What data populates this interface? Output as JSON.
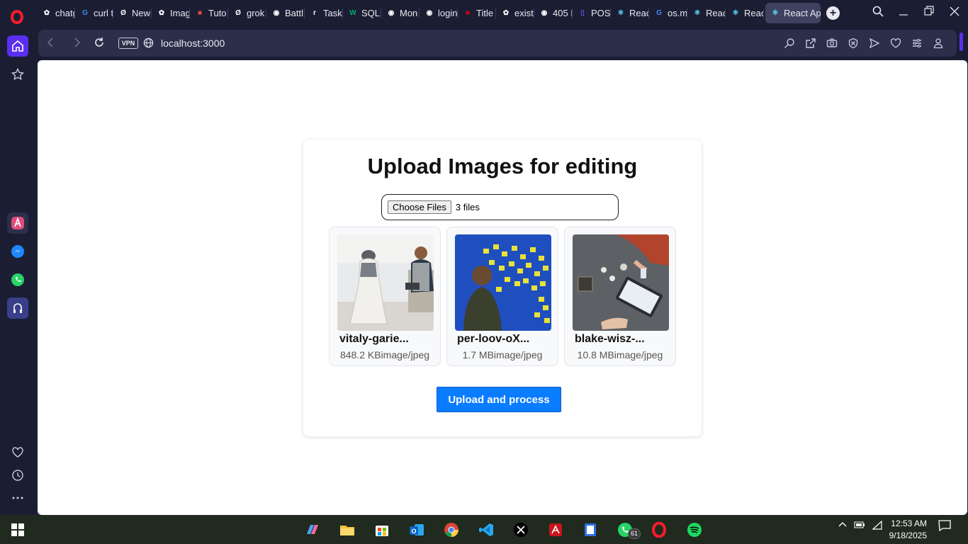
{
  "browser": {
    "tabs": [
      {
        "label": "chatgpt",
        "favicon": "openai-icon",
        "color": "#ffffff"
      },
      {
        "label": "curl t",
        "favicon": "google-icon",
        "color": "#4285f4"
      },
      {
        "label": "New",
        "favicon": "perplexity-icon",
        "color": "#ffffff"
      },
      {
        "label": "Imag",
        "favicon": "openai-icon",
        "color": "#ffffff"
      },
      {
        "label": "Tuto",
        "favicon": "site-icon",
        "color": "#e24a3b"
      },
      {
        "label": "grok",
        "favicon": "grok-icon",
        "color": "#ffffff"
      },
      {
        "label": "Battl",
        "favicon": "globe-icon",
        "color": "#ffffff"
      },
      {
        "label": "Task",
        "favicon": "r-icon",
        "color": "#ffffff"
      },
      {
        "label": "SQL",
        "favicon": "w3-icon",
        "color": "#04aa6d"
      },
      {
        "label": "Mon",
        "favicon": "globe-icon",
        "color": "#ffffff"
      },
      {
        "label": "login",
        "favicon": "globe-icon",
        "color": "#ffffff"
      },
      {
        "label": "Title",
        "favicon": "site-icon",
        "color": "#d0021b"
      },
      {
        "label": "exist",
        "favicon": "openai-icon",
        "color": "#ffffff"
      },
      {
        "label": "405 I",
        "favicon": "globe-icon",
        "color": "#ffffff"
      },
      {
        "label": "POST",
        "favicon": "doc-icon",
        "color": "#6b4cf6"
      },
      {
        "label": "Reac",
        "favicon": "react-icon",
        "color": "#61dafb"
      },
      {
        "label": "os.m",
        "favicon": "google-icon",
        "color": "#4285f4"
      },
      {
        "label": "Reac",
        "favicon": "react-icon",
        "color": "#61dafb"
      },
      {
        "label": "Reac",
        "favicon": "react-icon",
        "color": "#61dafb"
      }
    ],
    "active_tab": {
      "label": "React App",
      "favicon": "react-icon"
    },
    "url": "localhost:3000",
    "vpn_label": "VPN"
  },
  "page": {
    "title": "Upload Images for editing",
    "file_input": {
      "button_label": "Choose Files",
      "status": "3 files"
    },
    "files": [
      {
        "name": "vitaly-garie...",
        "meta": "848.2 KBimage/jpeg",
        "thumb": "dress-form-photo"
      },
      {
        "name": "per-loov-oX...",
        "meta": "1.7 MBimage/jpeg",
        "thumb": "sticky-notes-wall-photo"
      },
      {
        "name": "blake-wisz-...",
        "meta": "10.8 MBimage/jpeg",
        "thumb": "desk-tablet-photo"
      }
    ],
    "upload_button": "Upload and process"
  },
  "taskbar": {
    "whatsapp_badge": "61",
    "time": "12:53 AM",
    "date": "9/18/2025"
  },
  "colors": {
    "accent": "#0a7cff",
    "browser_bg": "#1b1e33",
    "sidebar_accent": "#5a2ff0"
  }
}
